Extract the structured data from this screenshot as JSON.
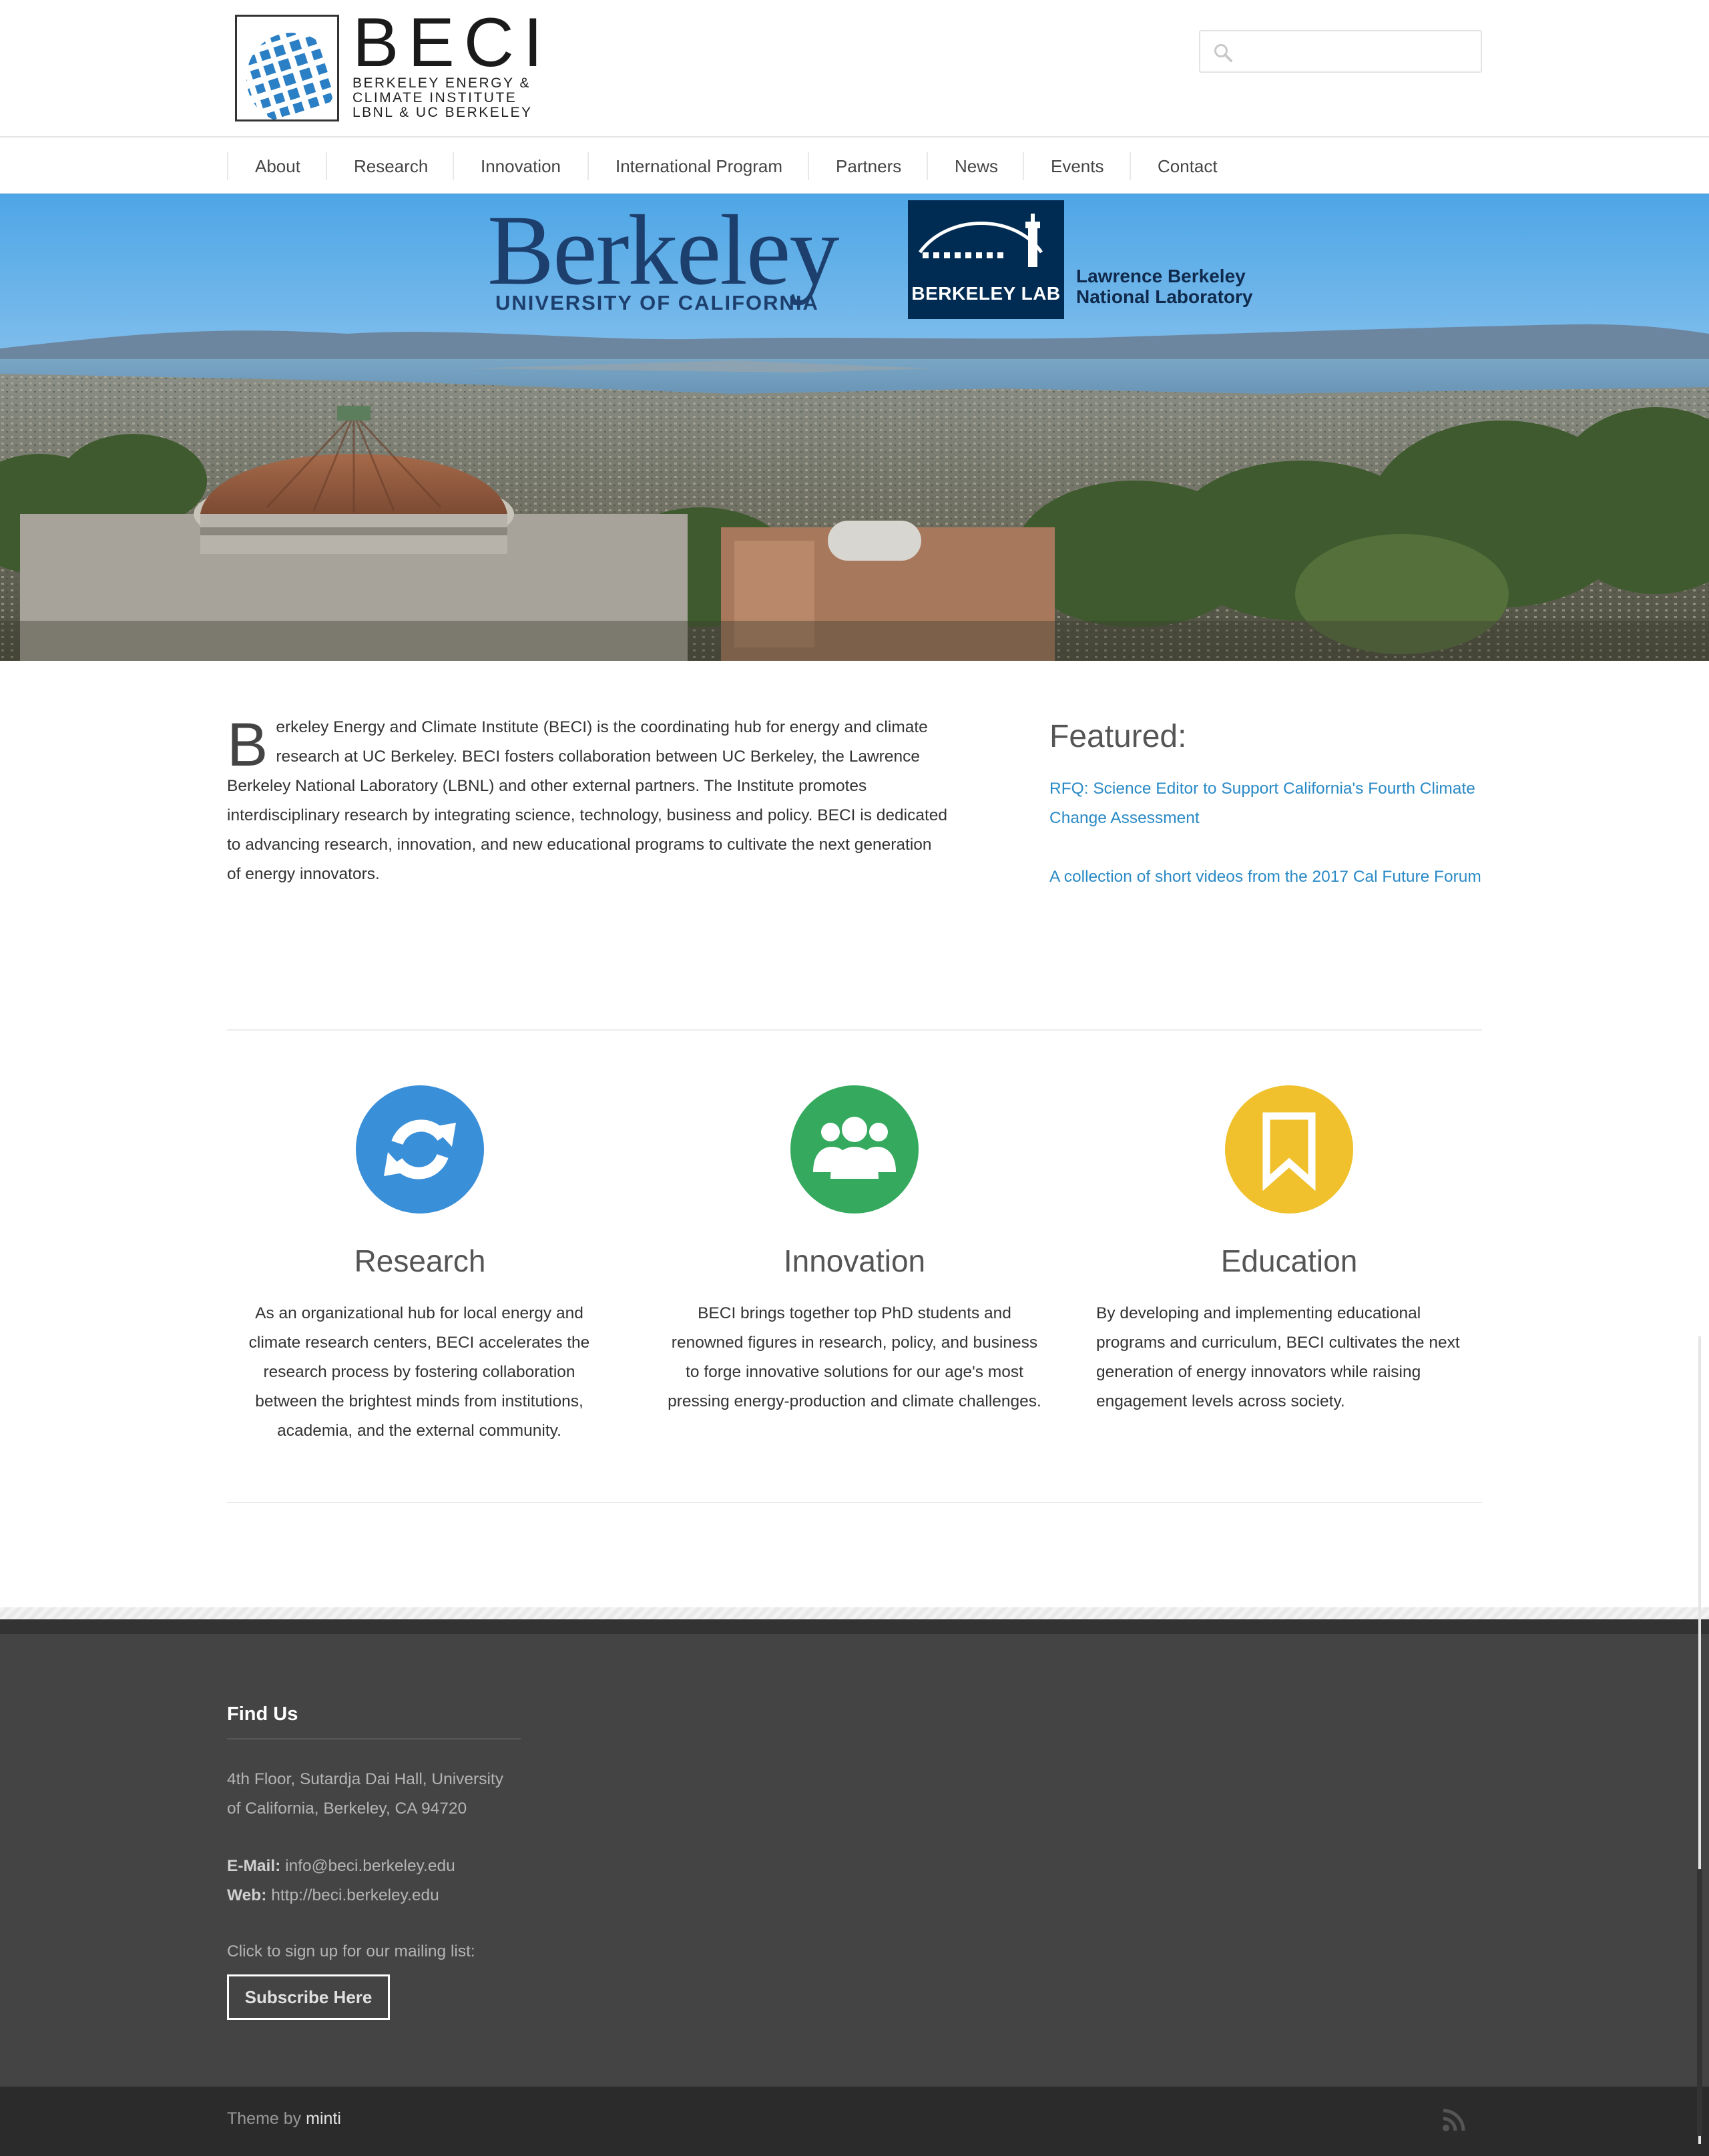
{
  "header": {
    "logo_big": "BECI",
    "logo_line1": "BERKELEY ENERGY &",
    "logo_line2": "CLIMATE INSTITUTE",
    "logo_line3": "LBNL & UC BERKELEY",
    "search_placeholder": ""
  },
  "nav": {
    "items": [
      {
        "label": "About"
      },
      {
        "label": "Research"
      },
      {
        "label": "Innovation"
      },
      {
        "label": "International Program"
      },
      {
        "label": "Partners"
      },
      {
        "label": "News"
      },
      {
        "label": "Events"
      },
      {
        "label": "Contact"
      }
    ]
  },
  "hero": {
    "berkeley_word": "Berkeley",
    "berkeley_sub": "UNIVERSITY OF CALIFORNIA",
    "lab_badge": "BERKELEY LAB",
    "lab_name_line1": "Lawrence Berkeley",
    "lab_name_line2": "National Laboratory"
  },
  "intro": {
    "dropcap": "B",
    "text": "erkeley Energy and Climate Institute (BECI) is the coordinating hub for energy and climate research at UC Berkeley. BECI fosters collaboration between UC Berkeley, the Lawrence Berkeley National Laboratory (LBNL) and other external partners. The Institute promotes interdisciplinary research by integrating science, technology, business and policy. BECI is dedicated to advancing research, innovation, and new educational programs to cultivate the next generation of energy innovators."
  },
  "featured": {
    "title": "Featured:",
    "links": [
      {
        "label": "RFQ: Science Editor to Support California's Fourth Climate Change Assessment"
      },
      {
        "label": "A collection of short videos from the 2017 Cal Future Forum"
      }
    ]
  },
  "features": [
    {
      "icon": "refresh-icon",
      "color": "#3a8fd9",
      "title": "Research",
      "text": "As an organizational hub for local energy and climate research centers, BECI accelerates the research process by fostering collaboration between the brightest minds from institutions, academia, and the external community."
    },
    {
      "icon": "users-icon",
      "color": "#35aa5e",
      "title": "Innovation",
      "text": "BECI brings together top PhD students and renowned figures in research, policy, and business to forge innovative solutions for our age's most pressing energy-production and climate challenges."
    },
    {
      "icon": "bookmark-icon",
      "color": "#f0c12c",
      "title": "Education",
      "text": "By developing and implementing educational programs and curriculum, BECI cultivates the next generation of energy innovators while raising engagement levels across society."
    }
  ],
  "footer": {
    "title": "Find Us",
    "address": "4th Floor, Sutardja Dai Hall, University of California, Berkeley, CA 94720",
    "email_label": "E-Mail:",
    "email": "info@beci.berkeley.edu",
    "web_label": "Web:",
    "web": "http://beci.berkeley.edu",
    "mailing_text": "Click to sign up for our mailing list:",
    "subscribe_label": "Subscribe Here",
    "theme_by": "Theme by",
    "theme_author": "minti"
  }
}
